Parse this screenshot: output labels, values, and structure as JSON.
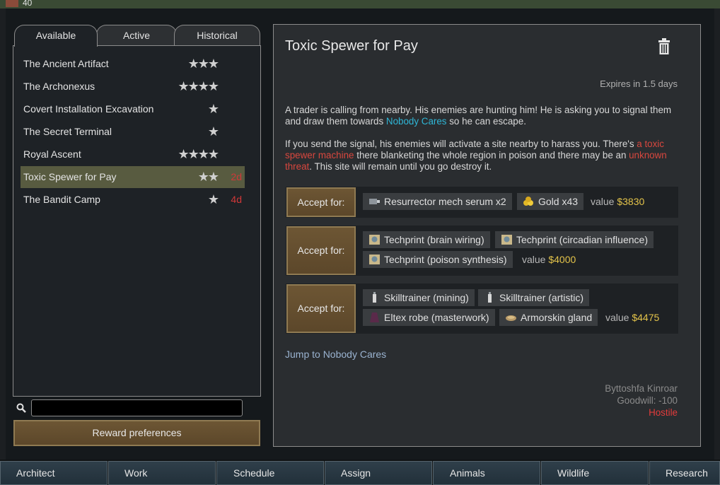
{
  "topbar": {
    "resource_count": "40"
  },
  "tabs": [
    {
      "label": "Available"
    },
    {
      "label": "Active"
    },
    {
      "label": "Historical"
    }
  ],
  "quests": [
    {
      "name": "The Ancient Artifact",
      "stars": "★★★",
      "expires": ""
    },
    {
      "name": "The Archonexus",
      "stars": "★★★★",
      "expires": ""
    },
    {
      "name": "Covert Installation Excavation",
      "stars": "★",
      "expires": ""
    },
    {
      "name": "The Secret Terminal",
      "stars": "★",
      "expires": ""
    },
    {
      "name": "Royal Ascent",
      "stars": "★★★★",
      "expires": ""
    },
    {
      "name": "Toxic Spewer for Pay",
      "stars": "★★",
      "expires": "2d"
    },
    {
      "name": "The Bandit Camp",
      "stars": "★",
      "expires": "4d"
    }
  ],
  "search": {
    "placeholder": ""
  },
  "reward_pref_label": "Reward preferences",
  "detail": {
    "title": "Toxic Spewer for Pay",
    "expires": "Expires in 1.5 days",
    "desc1_a": "A trader is calling from nearby. His enemies are hunting him! He is asking you to signal them and draw them towards ",
    "desc1_link": "Nobody Cares",
    "desc1_b": " so he can escape.",
    "desc2_a": "If you send the signal, his enemies will activate a site nearby to harass you. There's ",
    "desc2_red1": "a toxic spewer machine",
    "desc2_b": " there blanketing the whole region in poison and there may be an ",
    "desc2_red2": "unknown threat",
    "desc2_c": ". This site will remain until you go destroy it.",
    "accept_label": "Accept for:",
    "rewards": [
      {
        "items": [
          "Resurrector mech serum x2",
          "Gold x43"
        ],
        "value_label": "value",
        "value": "$3830"
      },
      {
        "items": [
          "Techprint (brain wiring)",
          "Techprint (circadian influence)",
          "Techprint (poison synthesis)"
        ],
        "value_label": "value",
        "value": "$4000"
      },
      {
        "items": [
          "Skilltrainer (mining)",
          "Skilltrainer (artistic)",
          "Eltex robe (masterwork)",
          "Armorskin gland"
        ],
        "value_label": "value",
        "value": "$4475"
      }
    ],
    "jump_label": "Jump to Nobody Cares",
    "faction_leader": "Byttoshfa Kinroar",
    "goodwill": "Goodwill: -100",
    "relation": "Hostile"
  },
  "bottom_tabs": [
    "Architect",
    "Work",
    "Schedule",
    "Assign",
    "Animals",
    "Wildlife",
    "Research"
  ],
  "colors": {
    "accent_link": "#2fb6d6",
    "danger": "#d8473e",
    "value_gold": "#e3c34a",
    "selected_row": "#585b40"
  }
}
